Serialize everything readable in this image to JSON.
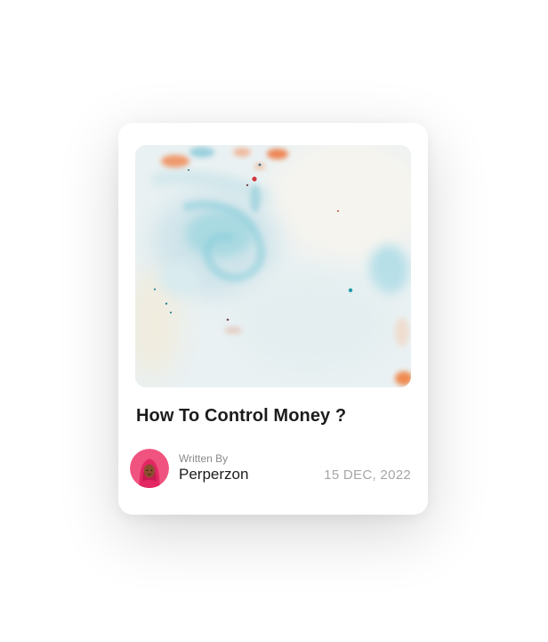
{
  "card": {
    "title": "How To Control Money ?",
    "author": {
      "label": "Written By",
      "name": "Perperzon"
    },
    "date": "15 DEC, 2022"
  },
  "colors": {
    "card_bg": "#ffffff",
    "title_text": "#1c1c1c",
    "muted_text": "#8a8a8a",
    "date_text": "#a6a6a6",
    "avatar_bg": "#f0537f"
  },
  "icons": {
    "avatar": "person-in-pink-hijab"
  }
}
